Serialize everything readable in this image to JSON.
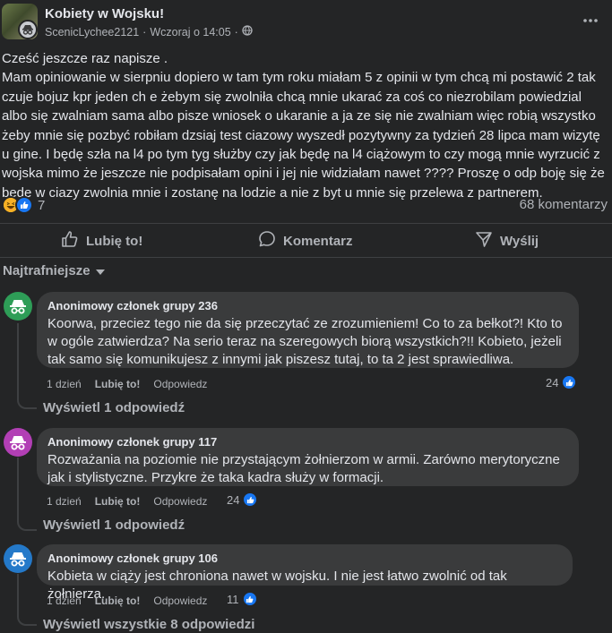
{
  "post": {
    "group_name": "Kobiety w Wojsku!",
    "author": "ScenicLychee2121",
    "separator": "·",
    "time": "Wczoraj o 14:05",
    "body": "Cześć jeszcze raz napisze .\nMam opiniowanie w sierpniu dopiero w tam tym roku miałam 5 z opinii w tym chcą mi postawić 2 tak czuje bojuz kpr jeden ch e żebym się zwolniła chcą mnie ukarać za coś co niezrobilam powiedzial albo się zwalniam sama albo pisze wniosek o ukaranie a ja ze się nie zwalniam więc robią wszystko żeby mnie się pozbyć robiłam dzsiaj test ciazowy wyszedł pozytywny za tydzień 28 lipca mam wizytę u gine. I będę szła na l4 po tym tyg służby czy jak będę na l4 ciążowym to czy mogą mnie wyrzucić z wojska mimo że jeszcze nie podpisałam opini i jej nie widziałam nawet ???? Proszę o odp boję się że będę w ciazy zwolnia mnie i zostanę na lodzie a nie z byt u mnie się przelewa z partnerem.",
    "reaction_count": "7",
    "comment_count": "68 komentarzy"
  },
  "actions": {
    "like": "Lubię to!",
    "comment": "Komentarz",
    "share": "Wyślij"
  },
  "sort_label": "Najtrafniejsze",
  "comments": [
    {
      "name": "Anonimowy członek grupy 236",
      "text": "Koorwa, przeciez tego nie da się przeczytać ze zrozumieniem! Co to za bełkot?! Kto to w ogóle zatwierdza? Na serio teraz na szeregowych biorą wszystkich?!! Kobieto, jeżeli tak samo się komunikujesz z innymi jak piszesz tutaj, to ta 2 jest sprawiedliwa.",
      "time": "1 dzień",
      "like": "Lubię to!",
      "reply": "Odpowiedz",
      "likes": "24",
      "view_replies": "Wyświetl 1 odpowiedź",
      "avatar_color": "#2e9d57"
    },
    {
      "name": "Anonimowy członek grupy 117",
      "text": "Rozważania na poziomie nie przystającym żołnierzom w armii. Zarówno merytoryczne jak i stylistyczne. Przykre że taka kadra służy w formacji.",
      "time": "1 dzień",
      "like": "Lubię to!",
      "reply": "Odpowiedz",
      "likes": "24",
      "view_replies": "Wyświetl 1 odpowiedź",
      "avatar_color": "#b23fb5"
    },
    {
      "name": "Anonimowy członek grupy 106",
      "text": "Kobieta w ciąży jest chroniona nawet w wojsku. I nie jest łatwo zwolnić od tak żołnierza.",
      "time": "1 dzień",
      "like": "Lubię to!",
      "reply": "Odpowiedz",
      "likes": "11",
      "view_replies": "Wyświetl wszystkie 8 odpowiedzi",
      "avatar_color": "#2479c9"
    }
  ]
}
